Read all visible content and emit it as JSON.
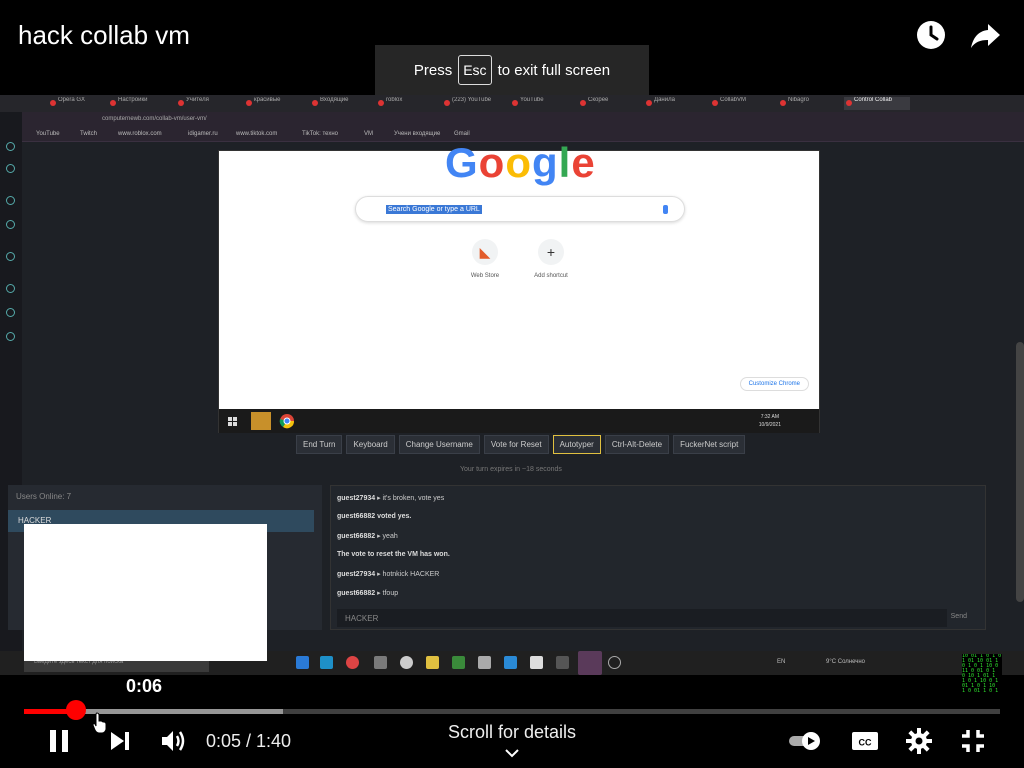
{
  "player": {
    "title": "hack collab vm",
    "fullscreen_hint": {
      "press": "Press",
      "key": "Esc",
      "rest": "to exit full screen"
    },
    "preview_time": "0:06",
    "time_display": "0:05 / 1:40",
    "scroll_label": "Scroll for details",
    "progress_played": 0.055,
    "progress_buffered": 0.265,
    "accent_color": "#ff0000",
    "icons": [
      "watch-later-icon",
      "share-icon",
      "pause-icon",
      "next-icon",
      "volume-icon",
      "autoplay-toggle-icon",
      "captions-icon",
      "settings-gear-icon",
      "exit-fullscreen-icon"
    ]
  },
  "recording": {
    "address": "computernewb.com/collab-vm/user-vm/",
    "bookmarks": [
      "YouTube",
      "Twitch",
      "www.roblox.com",
      "idigamer.ru",
      "www.tiktok.com",
      "TikTok: техно",
      "VM",
      "Учени входящие",
      "Gmail"
    ],
    "vm": {
      "search_placeholder": "Search Google or type a URL",
      "shortcuts": [
        "Web Store",
        "Add shortcut"
      ],
      "customize": "Customize Chrome",
      "clock_time": "7:32 AM",
      "clock_date": "10/9/2021"
    },
    "vm_buttons": [
      "End Turn",
      "Keyboard",
      "Change Username",
      "Vote for Reset",
      "Autotyper",
      "Ctrl-Alt-Delete",
      "FuckerNet script"
    ],
    "turn_text": "Your turn expires in ~18 seconds",
    "users_header": "Users Online: 7",
    "users": [
      "HACKER"
    ],
    "chat": [
      {
        "user": "guest27934",
        "msg": "it's broken, vote yes"
      },
      {
        "user": "guest66882 voted yes.",
        "msg": ""
      },
      {
        "user": "guest66882",
        "msg": "yeah"
      },
      {
        "user": "The vote to reset the VM has won.",
        "msg": ""
      },
      {
        "user": "guest27934",
        "msg": "hotnkick HACKER"
      },
      {
        "user": "guest66882",
        "msg": "tfoup"
      }
    ],
    "chat_input": "HACKER",
    "chat_send": "Send",
    "taskbar_search": "Введите здесь текст для поиска",
    "taskbar_lang": "EN",
    "taskbar_weather": "9°C Солнечно"
  }
}
